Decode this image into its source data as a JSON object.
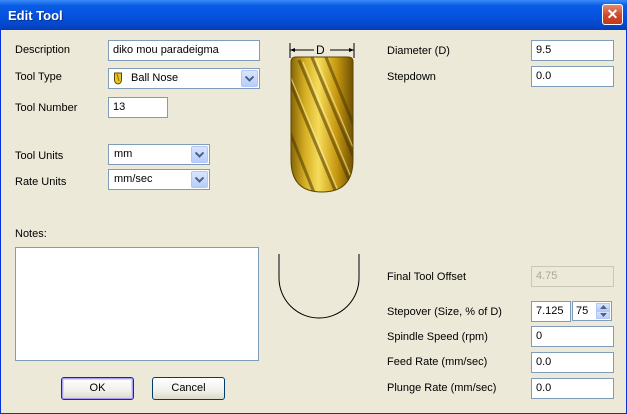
{
  "window": {
    "title": "Edit Tool",
    "close_glyph": "✕"
  },
  "form": {
    "description_label": "Description",
    "description_value": "diko mou paradeigma",
    "tool_type_label": "Tool Type",
    "tool_type_value": "Ball Nose",
    "tool_type_icon": "ball-nose-tool-icon",
    "tool_number_label": "Tool Number",
    "tool_number_value": "13",
    "tool_units_label": "Tool Units",
    "tool_units_value": "mm",
    "rate_units_label": "Rate Units",
    "rate_units_value": "mm/sec",
    "notes_label": "Notes:",
    "notes_value": ""
  },
  "preview": {
    "diameter_marker": "D",
    "tool_color": "#d9b530"
  },
  "params": {
    "diameter_label": "Diameter (D)",
    "diameter_value": "9.5",
    "stepdown_label": "Stepdown",
    "stepdown_value": "0.0",
    "final_offset_label": "Final Tool Offset",
    "final_offset_value": "4.75",
    "stepover_label": "Stepover (Size, % of D)",
    "stepover_size_value": "7.125",
    "stepover_percent_value": "75",
    "spindle_label": "Spindle Speed (rpm)",
    "spindle_value": "0",
    "feed_label": "Feed Rate (mm/sec)",
    "feed_value": "0.0",
    "plunge_label": "Plunge Rate (mm/sec)",
    "plunge_value": "0.0"
  },
  "buttons": {
    "ok_label": "OK",
    "cancel_label": "Cancel"
  }
}
